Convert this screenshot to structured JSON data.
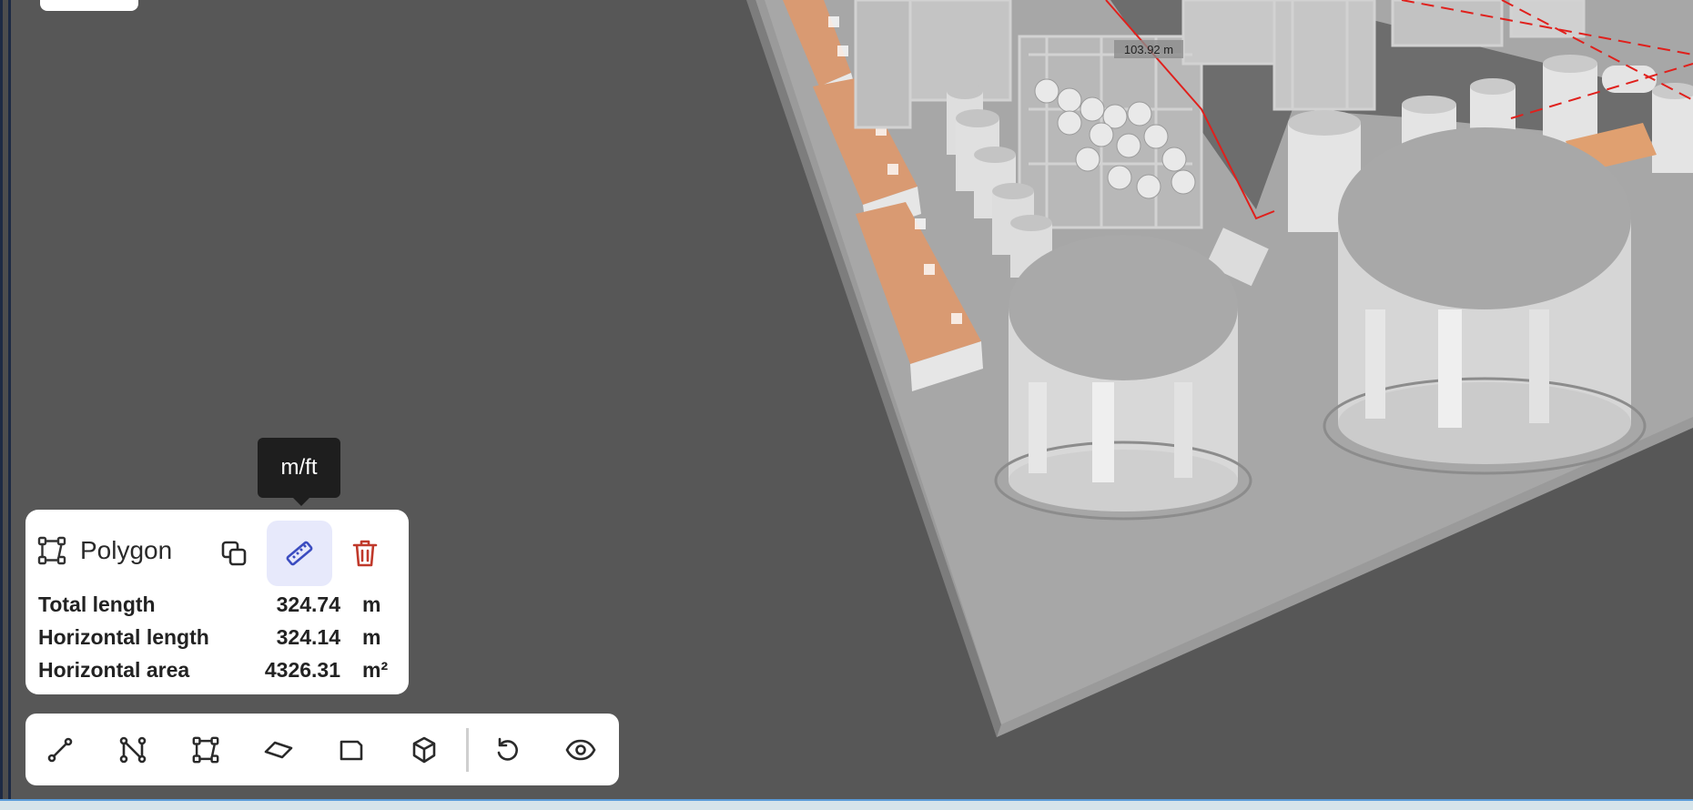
{
  "tooltip": {
    "text": "m/ft"
  },
  "scene": {
    "dimension_label": "103.92 m"
  },
  "measure_panel": {
    "shape_icon": "polygon-icon",
    "shape_label": "Polygon",
    "actions": [
      {
        "name": "duplicate",
        "icon": "copy-icon"
      },
      {
        "name": "units-toggle",
        "icon": "ruler-icon",
        "active": true
      },
      {
        "name": "delete",
        "icon": "trash-icon"
      }
    ],
    "rows": [
      {
        "label": "Total length",
        "value": "324.74",
        "unit": "m"
      },
      {
        "label": "Horizontal length",
        "value": "324.14",
        "unit": "m"
      },
      {
        "label": "Horizontal area",
        "value": "4326.31",
        "unit": "m²"
      }
    ]
  },
  "toolbar": {
    "tools": [
      {
        "name": "line",
        "icon": "line-measure-icon"
      },
      {
        "name": "polyline",
        "icon": "polyline-icon"
      },
      {
        "name": "polygon",
        "icon": "polygon-icon"
      },
      {
        "name": "area",
        "icon": "area-icon"
      },
      {
        "name": "surface",
        "icon": "surface-icon"
      },
      {
        "name": "volume",
        "icon": "cube-icon"
      },
      {
        "name": "reset",
        "icon": "rotate-ccw-icon"
      },
      {
        "name": "visibility",
        "icon": "eye-icon"
      }
    ]
  },
  "colors": {
    "accent": "#3b4cc0",
    "delete": "#c0392b",
    "measure_line": "#e0201c",
    "roof": "#d99a72"
  }
}
